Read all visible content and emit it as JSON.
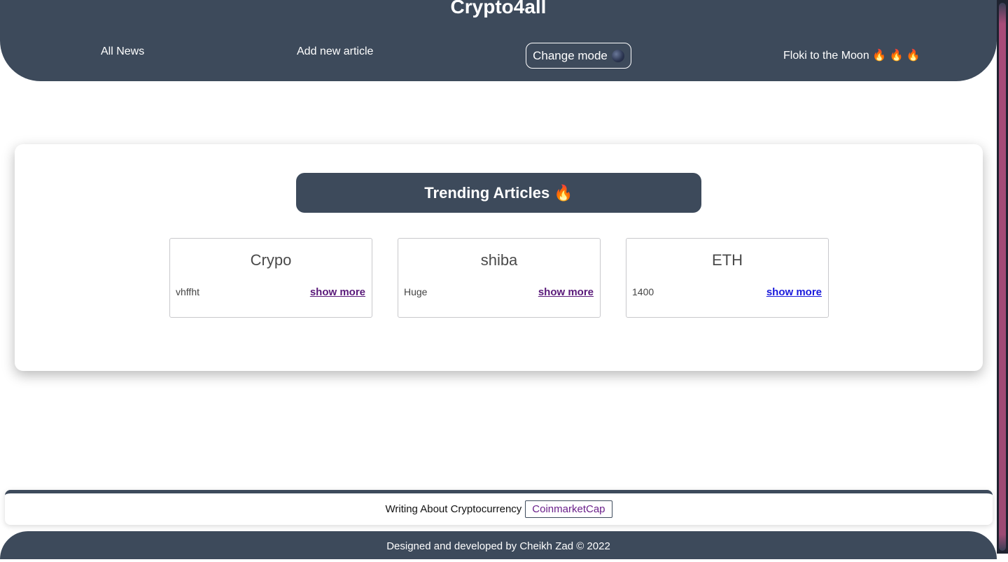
{
  "header": {
    "site_title": "Crypto4all",
    "nav": {
      "all_news": "All News",
      "add_article": "Add new article",
      "change_mode": "Change mode",
      "floki": "Floki to the Moon 🔥 🔥 🔥"
    },
    "mode_icon": "moon-icon"
  },
  "trending": {
    "title": "Trending Articles 🔥",
    "articles": [
      {
        "title": "Crypo",
        "desc": "vhffht",
        "link": "show more",
        "link_color": "#5a1a7a"
      },
      {
        "title": "shiba",
        "desc": "Huge",
        "link": "show more",
        "link_color": "#5a1a7a"
      },
      {
        "title": "ETH",
        "desc": "1400",
        "link": "show more",
        "link_color": "#1a1adc"
      }
    ]
  },
  "footer": {
    "text": "Writing About Cryptocurrency",
    "link": "CoinmarketCap",
    "credits": "Designed and developed by Cheikh Zad © 2022"
  },
  "colors": {
    "header_bg": "#3d4a5b",
    "accent": "#3d4a5b"
  }
}
